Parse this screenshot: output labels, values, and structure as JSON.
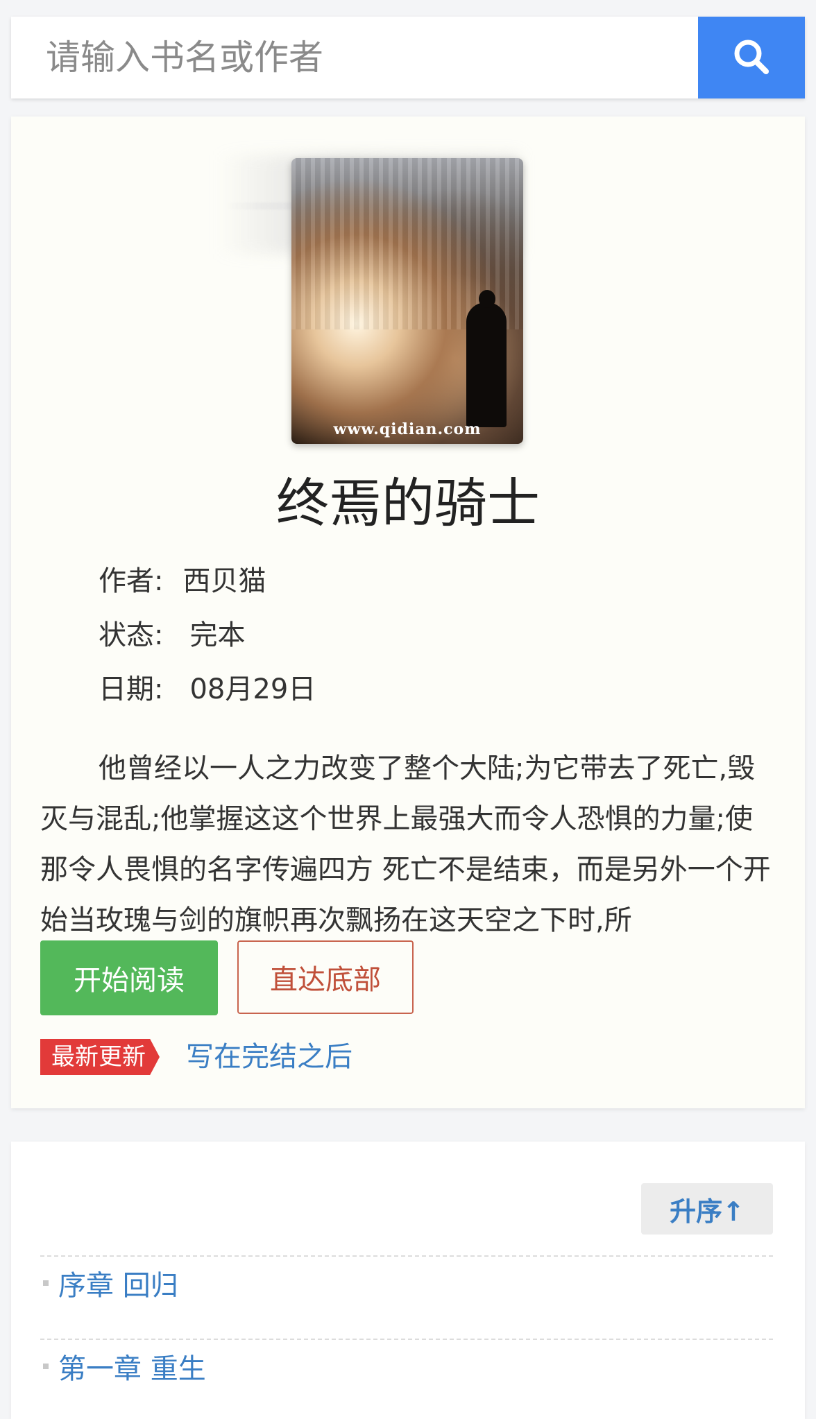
{
  "search": {
    "placeholder": "请输入书名或作者",
    "button_icon": "search-icon"
  },
  "book": {
    "cover_watermark": "www.qidian.com",
    "title": "终焉的骑士",
    "author_label": "作者:",
    "author": "西贝猫",
    "status_label": "状态:",
    "status": "完本",
    "date_label": "日期:",
    "date": "08月29日",
    "description": "他曾经以一人之力改变了整个大陆;为它带去了死亡,毁灭与混乱;他掌握这这个世界上最强大而令人恐惧的力量;使那令人畏惧的名字传遍四方 死亡不是结束，而是另外一个开始当玫瑰与剑的旗帜再次飘扬在这天空之下时,所"
  },
  "actions": {
    "start_reading": "开始阅读",
    "go_bottom": "直达底部"
  },
  "latest": {
    "badge": "最新更新",
    "chapter": "写在完结之后"
  },
  "chapters": {
    "sort_label": "升序↑",
    "items": [
      {
        "title": "序章 回归"
      },
      {
        "title": "第一章 重生"
      }
    ]
  },
  "colors": {
    "accent_blue": "#3f86f3",
    "read_green": "#53b85a",
    "badge_red": "#e23a39",
    "link_blue": "#3a7ec4",
    "outline_red": "#c8644e"
  }
}
